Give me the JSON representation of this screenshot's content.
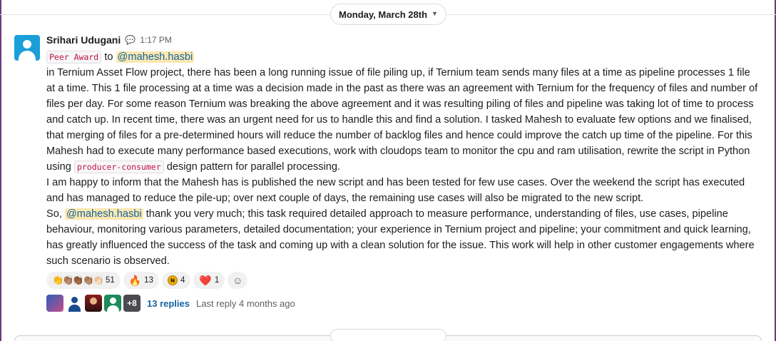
{
  "day_divider": {
    "label": "Monday, March 28th"
  },
  "message": {
    "sender": "Srihari Udugani",
    "time": "1:17 PM",
    "award_tag": "Peer Award",
    "to_word": "to",
    "mention": "@mahesh.hasbi",
    "body_part1": "in Ternium Asset Flow project, there has been a long running issue of file piling up, if Ternium team sends many files at a time as pipeline processes 1 file at a time. This 1 file processing at a time was a decision made in the past as there was an agreement with Ternium for the frequency of files and number of files per day. For some reason Ternium was breaking the above agreement and it was resulting piling of files and pipeline was taking lot of time to process and catch up. In recent time, there was an urgent need for us to handle this and find a solution. I tasked Mahesh to evaluate few options and we finalised, that merging of files for a pre-determined hours will reduce the number of backlog files and hence could improve the catch up time of the pipeline. For this Mahesh had to execute many performance based executions, work with cloudops team to monitor the cpu and ram utilisation, rewrite the script in Python using",
    "code_snippet": "producer-consumer",
    "body_part2": "design pattern for parallel processing.",
    "body_part3": "I am happy to inform that the Mahesh has is published the new script and has been tested for few use cases. Over the weekend the script has executed and has managed to reduce the pile-up; over next couple of days, the remaining use cases will also be migrated to the new script.",
    "so_word": "So,",
    "body_part4": "thank you very much; this task required detailed approach to measure performance, understanding of files, use cases, pipeline behaviour, monitoring various parameters, detailed documentation; your experience in Ternium project and pipeline; your commitment and quick learning, has greatly influenced the success of the task and coming up with a clean solution for the issue. This work will help in other customer engagements where such scenario is observed."
  },
  "reactions": [
    {
      "emoji": "👏👏🏽👏🏾👏🏽👏🏻",
      "count": "51"
    },
    {
      "emoji": "🔥",
      "count": "13"
    },
    {
      "emoji": "coin",
      "count": "4"
    },
    {
      "emoji": "❤️",
      "count": "1"
    }
  ],
  "thread": {
    "more_count": "+8",
    "replies": "13 replies",
    "last_reply": "Last reply 4 months ago"
  },
  "colors": {
    "accent": "#1264a3",
    "mention_bg": "#fbe7b0",
    "frame": "#6a3b7a"
  }
}
